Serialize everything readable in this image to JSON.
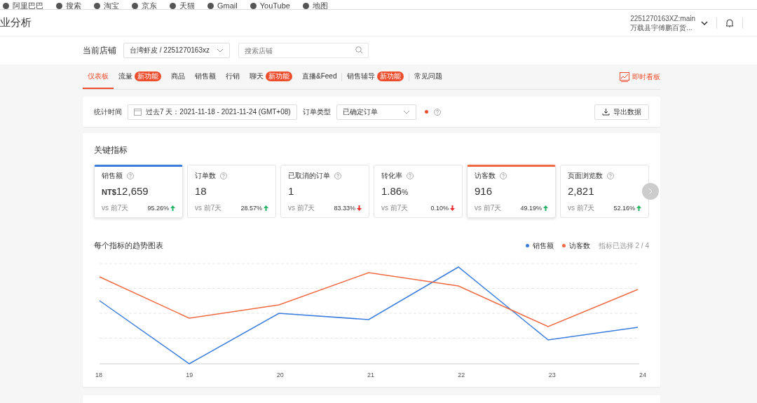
{
  "bookmarks": [
    "阿里巴巴",
    "搜索",
    "淘宝",
    "京东",
    "天猫",
    "Gmail",
    "YouTube",
    "地图"
  ],
  "header": {
    "title": "业分析",
    "account": "2251270163XZ:main",
    "shop_name": "万载县宇傅鹏百货..."
  },
  "store": {
    "label": "当前店铺",
    "value": "台湾虾皮 / 2251270163xz",
    "search_placeholder": "搜索店铺"
  },
  "tabs": [
    {
      "label": "仪表板",
      "selected": true
    },
    {
      "label": "流量",
      "selected": false,
      "badge": "新功能"
    },
    {
      "label": "商品",
      "selected": false
    },
    {
      "label": "销售额",
      "selected": false
    },
    {
      "label": "行销",
      "selected": false
    },
    {
      "label": "聊天",
      "selected": false,
      "badge": "新功能"
    },
    {
      "label": "直播&Feed",
      "selected": false
    },
    {
      "label": "销售辅导",
      "selected": false,
      "badge": "新功能",
      "separator_before": true
    },
    {
      "label": "常见问题",
      "selected": false,
      "separator_before": true
    }
  ],
  "live_board": "即时看板",
  "filter": {
    "time_label": "统计时间",
    "time_value": "过去7 天：2021-11-18 - 2021-11-24 (GMT+08)",
    "order_label": "订单类型",
    "order_value": "已确定订单",
    "export": "导出数据"
  },
  "metrics_title": "关键指标",
  "metrics": [
    {
      "label": "销售额",
      "prefix": "NT$",
      "value": "12,659",
      "compare": "vs 前7天",
      "change": "95.26%",
      "increase": true,
      "selected": true,
      "color": "#3b7ddd"
    },
    {
      "label": "订单数",
      "value": "18",
      "compare": "vs 前7天",
      "change": "28.57%",
      "increase": true,
      "selected": false
    },
    {
      "label": "已取消的订单",
      "value": "1",
      "compare": "vs 前7天",
      "change": "83.33%",
      "increase": false,
      "selected": false
    },
    {
      "label": "转化率",
      "value": "1.86",
      "suffix": "%",
      "compare": "vs 前7天",
      "change": "0.10%",
      "increase": false,
      "selected": false
    },
    {
      "label": "访客数",
      "value": "916",
      "compare": "vs 前7天",
      "change": "49.19%",
      "increase": true,
      "selected": true,
      "color": "#f06a43"
    },
    {
      "label": "页面浏览数",
      "value": "2,821",
      "compare": "vs 前7天",
      "change": "52.16%",
      "increase": true,
      "selected": false
    }
  ],
  "trend": {
    "title": "每个指标的趋势图表",
    "legend": [
      {
        "name": "销售额",
        "color": "#3b7ddd"
      },
      {
        "name": "访客数",
        "color": "#f06a43"
      }
    ],
    "selected_count": "指标已选择 2 / 4",
    "x_labels": [
      "18",
      "19",
      "20",
      "21",
      "22",
      "23",
      "24"
    ]
  }
}
